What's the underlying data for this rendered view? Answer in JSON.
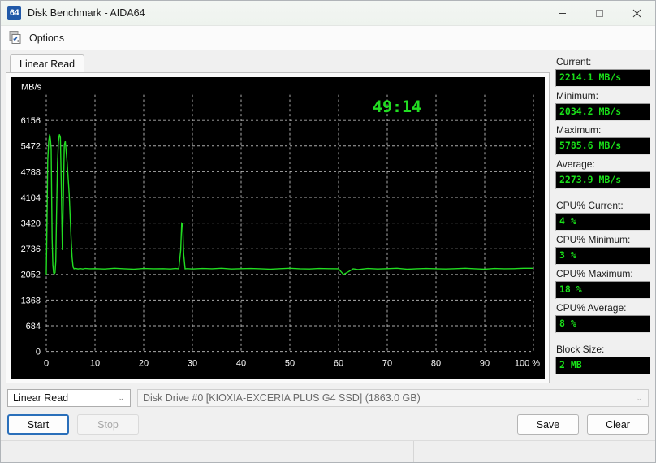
{
  "window": {
    "title": "Disk Benchmark - AIDA64",
    "app_icon_text": "64",
    "minimize_label": "minimize",
    "maximize_label": "maximize",
    "close_label": "close"
  },
  "toolbar": {
    "options_label": "Options"
  },
  "tabs": [
    {
      "label": "Linear Read",
      "active": true
    }
  ],
  "stats": [
    {
      "label": "Current:",
      "value": "2214.1 MB/s",
      "gap": false
    },
    {
      "label": "Minimum:",
      "value": "2034.2 MB/s",
      "gap": false
    },
    {
      "label": "Maximum:",
      "value": "5785.6 MB/s",
      "gap": false
    },
    {
      "label": "Average:",
      "value": "2273.9 MB/s",
      "gap": false
    },
    {
      "label": "CPU% Current:",
      "value": "4 %",
      "gap": true
    },
    {
      "label": "CPU% Minimum:",
      "value": "3 %",
      "gap": false
    },
    {
      "label": "CPU% Maximum:",
      "value": "18 %",
      "gap": false
    },
    {
      "label": "CPU% Average:",
      "value": "8 %",
      "gap": false
    },
    {
      "label": "Block Size:",
      "value": "2 MB",
      "gap": true
    }
  ],
  "controls": {
    "mode_value": "Linear Read",
    "drive_value": "Disk Drive #0  [KIOXIA-EXCERIA PLUS G4 SSD]  (1863.0 GB)",
    "start_label": "Start",
    "stop_label": "Stop",
    "save_label": "Save",
    "clear_label": "Clear",
    "chevron": "⌄"
  },
  "statusbar": {
    "pane1": "",
    "pane2": ""
  },
  "colors": {
    "trace": "#22dd22",
    "grid": "#c9c9c9",
    "plot_bg": "#000000",
    "value_text": "#19e019",
    "accent": "#2a6fba"
  },
  "chart_data": {
    "type": "line",
    "title": "",
    "timer": "49:14",
    "xlabel": "100 %",
    "ylabel": "MB/s",
    "xlim": [
      0,
      100
    ],
    "ylim": [
      0,
      6840
    ],
    "grid": true,
    "x_ticks": [
      0,
      10,
      20,
      30,
      40,
      50,
      60,
      70,
      80,
      90,
      100
    ],
    "x_tick_labels": [
      "0",
      "10",
      "20",
      "30",
      "40",
      "50",
      "60",
      "70",
      "80",
      "90",
      "100 %"
    ],
    "y_ticks": [
      0,
      684,
      1368,
      2052,
      2736,
      3420,
      4104,
      4788,
      5472,
      6156
    ],
    "y_tick_labels": [
      "0",
      "684",
      "1368",
      "2052",
      "2736",
      "3420",
      "4104",
      "4788",
      "5472",
      "6156"
    ],
    "series": [
      {
        "name": "Linear Read",
        "color": "#22dd22",
        "x": [
          0.0,
          0.15,
          0.3,
          0.5,
          0.7,
          0.85,
          1.0,
          1.1,
          1.2,
          1.35,
          1.5,
          1.6,
          1.7,
          1.8,
          1.95,
          2.1,
          2.3,
          2.5,
          2.7,
          2.9,
          3.1,
          3.3,
          3.5,
          3.7,
          3.9,
          4.1,
          4.3,
          4.5,
          4.7,
          4.9,
          5.1,
          5.3,
          5.5,
          5.7,
          5.9,
          6.1,
          6.3,
          6.5,
          6.7,
          7.0,
          7.5,
          8.0,
          9.0,
          10.0,
          12.0,
          14.0,
          16.0,
          18.0,
          20.0,
          22.0,
          24.0,
          25.5,
          26.5,
          27.2,
          27.6,
          27.8,
          28.0,
          28.2,
          28.5,
          29.0,
          30.0,
          32.0,
          34.0,
          36.0,
          38.0,
          40.0,
          42.0,
          44.0,
          46.0,
          48.0,
          50.0,
          52.0,
          54.0,
          56.0,
          58.0,
          60.0,
          61.0,
          62.0,
          63.0,
          64.0,
          66.0,
          68.0,
          70.0,
          72.0,
          74.0,
          76.0,
          78.0,
          80.0,
          82.0,
          84.0,
          86.0,
          88.0,
          90.0,
          92.0,
          94.0,
          96.0,
          98.0,
          100.0
        ],
        "y": [
          2052,
          3500,
          5100,
          5600,
          5785,
          5650,
          5400,
          4200,
          3000,
          2300,
          2100,
          2060,
          2080,
          2100,
          2400,
          3600,
          5000,
          5600,
          5785,
          5700,
          4300,
          2700,
          4100,
          5500,
          5600,
          5300,
          5000,
          4600,
          4200,
          3600,
          3000,
          2500,
          2250,
          2200,
          2210,
          2200,
          2205,
          2195,
          2200,
          2205,
          2195,
          2210,
          2200,
          2205,
          2195,
          2215,
          2200,
          2190,
          2210,
          2200,
          2205,
          2195,
          2210,
          2200,
          2700,
          3420,
          3400,
          2600,
          2200,
          2205,
          2195,
          2210,
          2200,
          2215,
          2195,
          2205,
          2210,
          2200,
          2190,
          2205,
          2215,
          2200,
          2195,
          2210,
          2205,
          2200,
          2050,
          2120,
          2200,
          2180,
          2210,
          2195,
          2205,
          2215,
          2190,
          2200,
          2210,
          2200,
          2195,
          2205,
          2215,
          2200,
          2190,
          2210,
          2200,
          2205,
          2214,
          2214
        ]
      }
    ]
  }
}
